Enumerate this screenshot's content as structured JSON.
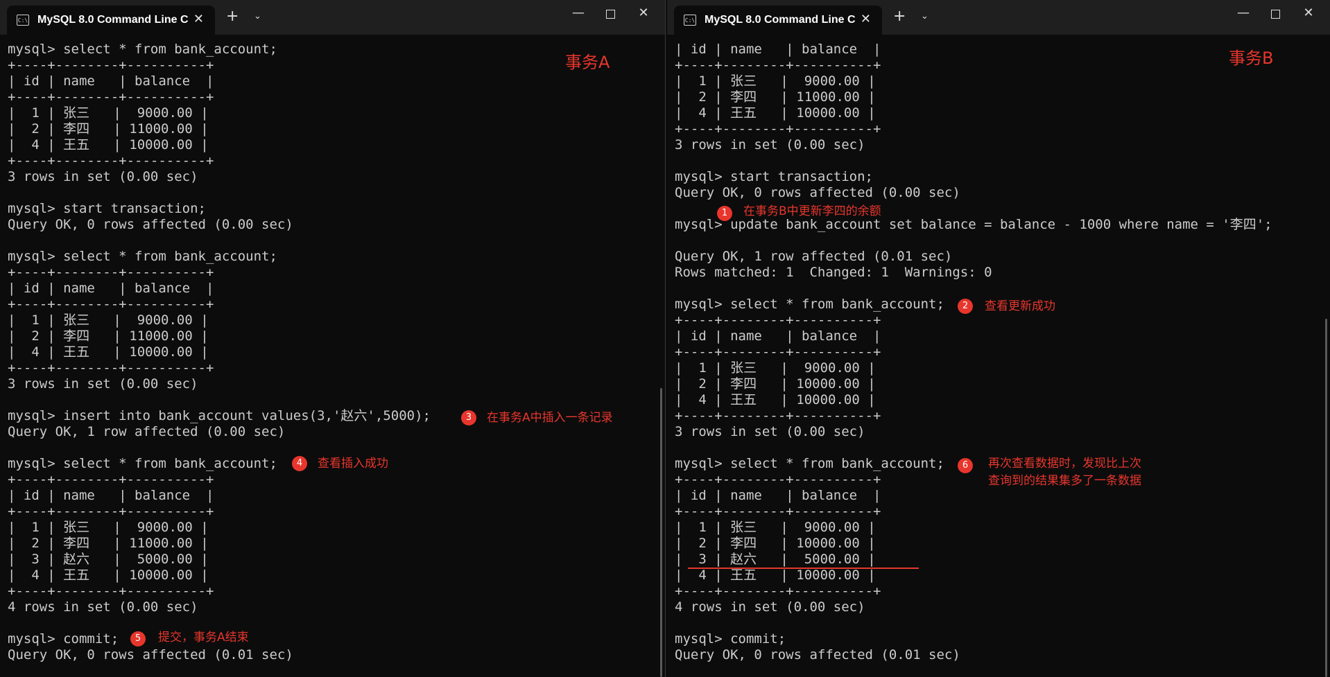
{
  "windowA": {
    "tab_title": "MySQL 8.0 Command Line C",
    "tab_icon_text": "C:\\",
    "label": "事务A",
    "lines": [
      "mysql> select * from bank_account;",
      "+----+--------+----------+",
      "| id | name   | balance  |",
      "+----+--------+----------+",
      "|  1 | 张三   |  9000.00 |",
      "|  2 | 李四   | 11000.00 |",
      "|  4 | 王五   | 10000.00 |",
      "+----+--------+----------+",
      "3 rows in set (0.00 sec)",
      "",
      "mysql> start transaction;",
      "Query OK, 0 rows affected (0.00 sec)",
      "",
      "mysql> select * from bank_account;",
      "+----+--------+----------+",
      "| id | name   | balance  |",
      "+----+--------+----------+",
      "|  1 | 张三   |  9000.00 |",
      "|  2 | 李四   | 11000.00 |",
      "|  4 | 王五   | 10000.00 |",
      "+----+--------+----------+",
      "3 rows in set (0.00 sec)",
      "",
      "mysql> insert into bank_account values(3,'赵六',5000);",
      "Query OK, 1 row affected (0.00 sec)",
      "",
      "mysql> select * from bank_account;",
      "+----+--------+----------+",
      "| id | name   | balance  |",
      "+----+--------+----------+",
      "|  1 | 张三   |  9000.00 |",
      "|  2 | 李四   | 11000.00 |",
      "|  3 | 赵六   |  5000.00 |",
      "|  4 | 王五   | 10000.00 |",
      "+----+--------+----------+",
      "4 rows in set (0.00 sec)",
      "",
      "mysql> commit;",
      "Query OK, 0 rows affected (0.01 sec)"
    ],
    "annotations": [
      {
        "num": "3",
        "text": "在事务A中插入一条记录"
      },
      {
        "num": "4",
        "text": "查看插入成功"
      },
      {
        "num": "5",
        "text": "提交，事务A结束"
      }
    ]
  },
  "windowB": {
    "tab_title": "MySQL 8.0 Command Line C",
    "tab_icon_text": "C:\\",
    "label": "事务B",
    "lines": [
      "| id | name   | balance  |",
      "+----+--------+----------+",
      "|  1 | 张三   |  9000.00 |",
      "|  2 | 李四   | 11000.00 |",
      "|  4 | 王五   | 10000.00 |",
      "+----+--------+----------+",
      "3 rows in set (0.00 sec)",
      "",
      "mysql> start transaction;",
      "Query OK, 0 rows affected (0.00 sec)",
      "",
      "mysql> update bank_account set balance = balance - 1000 where name = '李四';",
      "",
      "Query OK, 1 row affected (0.01 sec)",
      "Rows matched: 1  Changed: 1  Warnings: 0",
      "",
      "mysql> select * from bank_account;",
      "+----+--------+----------+",
      "| id | name   | balance  |",
      "+----+--------+----------+",
      "|  1 | 张三   |  9000.00 |",
      "|  2 | 李四   | 10000.00 |",
      "|  4 | 王五   | 10000.00 |",
      "+----+--------+----------+",
      "3 rows in set (0.00 sec)",
      "",
      "mysql> select * from bank_account;",
      "+----+--------+----------+",
      "| id | name   | balance  |",
      "+----+--------+----------+",
      "|  1 | 张三   |  9000.00 |",
      "|  2 | 李四   | 10000.00 |",
      "|  3 | 赵六   |  5000.00 |",
      "|  4 | 王五   | 10000.00 |",
      "+----+--------+----------+",
      "4 rows in set (0.00 sec)",
      "",
      "mysql> commit;",
      "Query OK, 0 rows affected (0.01 sec)"
    ],
    "annotations": [
      {
        "num": "1",
        "text": "在事务B中更新李四的余额"
      },
      {
        "num": "2",
        "text": "查看更新成功"
      },
      {
        "num": "6",
        "text": "再次查看数据时，发现比上次",
        "text2": "查询到的结果集多了一条数据"
      }
    ]
  },
  "colors": {
    "terminal_bg": "#0c0c0c",
    "terminal_text": "#cccccc",
    "annotation_red": "#e8362d"
  }
}
